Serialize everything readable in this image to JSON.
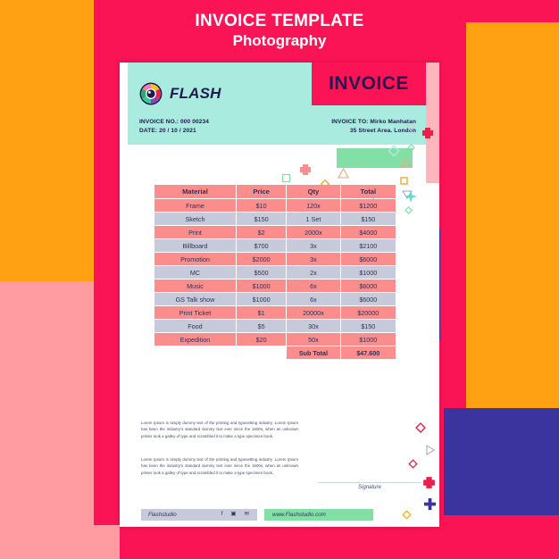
{
  "poster": {
    "title": "INVOICE TEMPLATE",
    "subtitle": "Photography",
    "colors": {
      "background_crimson": "#fb1455",
      "orange": "#ffa113",
      "pink": "#fe9ca2",
      "blue": "#3b339e",
      "teal": "#a9ecdf",
      "green": "#82e0a6",
      "salmon_row": "#fb8d8d",
      "gray_row": "#c6cada",
      "navy_text": "#221952"
    }
  },
  "invoice": {
    "brand": {
      "logo_icon": "camera-aperture-icon",
      "name": "FLASH"
    },
    "heading_label": "INVOICE",
    "meta_left": [
      "INVOICE NO.: 000 00234",
      "DATE: 20 / 10 / 2021"
    ],
    "meta_right": [
      "INVOICE TO: Mirko Manhatan",
      "35 Street Area. London"
    ],
    "table": {
      "columns": [
        "Material",
        "Price",
        "Qty",
        "Total"
      ],
      "rows": [
        {
          "material": "Frame",
          "price": "$10",
          "qty": "120x",
          "total": "$1200"
        },
        {
          "material": "Sketch",
          "price": "$150",
          "qty": "1 Set",
          "total": "$150"
        },
        {
          "material": "Print",
          "price": "$2",
          "qty": "2000x",
          "total": "$4000"
        },
        {
          "material": "Billboard",
          "price": "$700",
          "qty": "3x",
          "total": "$2100"
        },
        {
          "material": "Promotion",
          "price": "$2000",
          "qty": "3x",
          "total": "$6000"
        },
        {
          "material": "MC",
          "price": "$500",
          "qty": "2x",
          "total": "$1000"
        },
        {
          "material": "Music",
          "price": "$1000",
          "qty": "6x",
          "total": "$6000"
        },
        {
          "material": "GS Talk show",
          "price": "$1000",
          "qty": "6x",
          "total": "$6000"
        },
        {
          "material": "Print Ticket",
          "price": "$1",
          "qty": "20000x",
          "total": "$20000"
        },
        {
          "material": "Food",
          "price": "$5",
          "qty": "30x",
          "total": "$150"
        },
        {
          "material": "Expedition",
          "price": "$20",
          "qty": "50x",
          "total": "$1000"
        }
      ],
      "subtotal_label": "Sub Total",
      "subtotal_value": "$47.600"
    },
    "paragraphs": [
      "Lorem Ipsum is simply dummy text of the printing and typesetting industry .Lorem Ipsum has been the industry's standard dummy text ever since the 1500s, when an unknown printer took a galley of type and scrambled it to make a type specimen book.",
      "Lorem Ipsum is simply dummy text of the printing and typesetting industry .Lorem Ipsum has been the industry's standard dummy text ever since the 1500s, when an unknown printer took a galley of type and scrambled it to make a type specimen book."
    ],
    "signature_label": "Signature",
    "footer": {
      "studio_name": "Flashstudio",
      "social": [
        {
          "icon": "facebook-icon",
          "glyph": "f"
        },
        {
          "icon": "instagram-icon",
          "glyph": "▣"
        },
        {
          "icon": "twitter-icon",
          "glyph": "✉"
        }
      ],
      "website": "www.Flashstudio.com"
    }
  },
  "decorations": {
    "dot_grid": "blue-dot-grid",
    "stripes": "blue-vertical-stripes",
    "left_dots": "red-dot-grid",
    "shapes": [
      "triangle-outline",
      "diamond-outline",
      "cross-shape",
      "plus-shape",
      "square-outline",
      "star-shape"
    ]
  }
}
